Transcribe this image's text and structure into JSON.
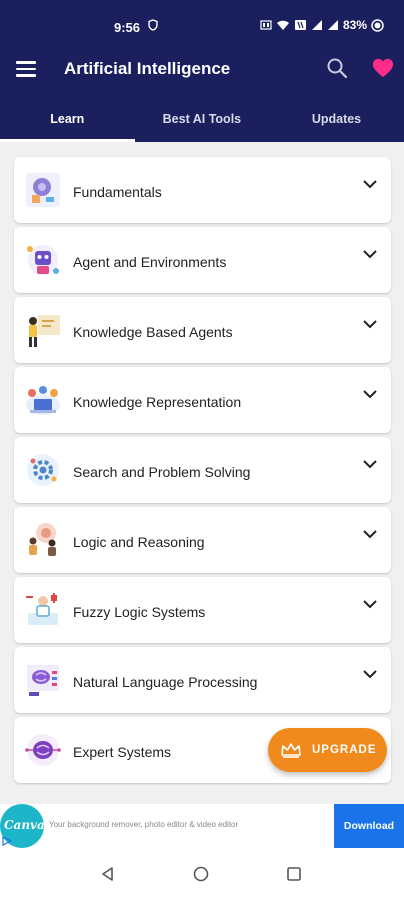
{
  "status_bar": {
    "time": "9:56",
    "battery": "83%"
  },
  "app_bar": {
    "title": "Artificial Intelligence"
  },
  "tabs": [
    {
      "label": "Learn",
      "active": true
    },
    {
      "label": "Best AI Tools",
      "active": false
    },
    {
      "label": "Updates",
      "active": false
    }
  ],
  "topics": [
    {
      "label": "Fundamentals",
      "icon": "brain-head-icon"
    },
    {
      "label": "Agent and Environments",
      "icon": "robot-agent-icon"
    },
    {
      "label": "Knowledge Based Agents",
      "icon": "person-board-icon"
    },
    {
      "label": "Knowledge Representation",
      "icon": "team-laptop-icon"
    },
    {
      "label": "Search and Problem Solving",
      "icon": "gear-search-icon"
    },
    {
      "label": "Logic and Reasoning",
      "icon": "people-thinking-icon"
    },
    {
      "label": "Fuzzy Logic Systems",
      "icon": "doctor-robot-icon"
    },
    {
      "label": "Natural Language Processing",
      "icon": "brain-screen-icon"
    },
    {
      "label": "Expert Systems",
      "icon": "brain-circuit-icon"
    }
  ],
  "upgrade": {
    "label": "UPGRADE"
  },
  "ad": {
    "brand": "Canva",
    "text": "Your background remover, photo editor & video editor",
    "cta": "Download"
  },
  "colors": {
    "primary": "#1b1f5e",
    "accent": "#f08a1c",
    "heart": "#ff2d8a",
    "ad_button": "#1a73e8"
  }
}
